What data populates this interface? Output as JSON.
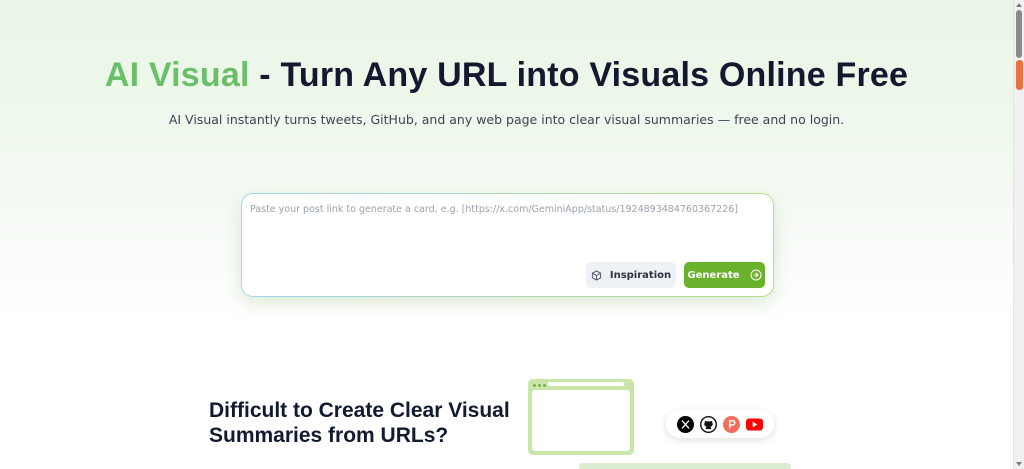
{
  "hero": {
    "title_accent": "AI Visual",
    "title_rest": " - Turn Any URL into Visuals Online Free",
    "subtitle": "AI Visual instantly turns tweets, GitHub, and any web page into clear visual summaries — free and no login."
  },
  "input_card": {
    "placeholder": "Paste your post link to generate a card, e.g. [https://x.com/GeminiApp/status/1924893484760367226]",
    "value": "",
    "inspiration_label": "Inspiration",
    "generate_label": "Generate"
  },
  "section": {
    "title": "Difficult to Create Clear Visual Summaries from URLs?"
  },
  "social_icons": [
    "x-icon",
    "github-icon",
    "producthunt-icon",
    "youtube-icon"
  ],
  "colors": {
    "accent_green": "#6cbf6a",
    "button_green": "#6ab12c",
    "title_dark": "#111a2e",
    "youtube_red": "#ff0000",
    "producthunt_coral": "#f26d5b"
  }
}
